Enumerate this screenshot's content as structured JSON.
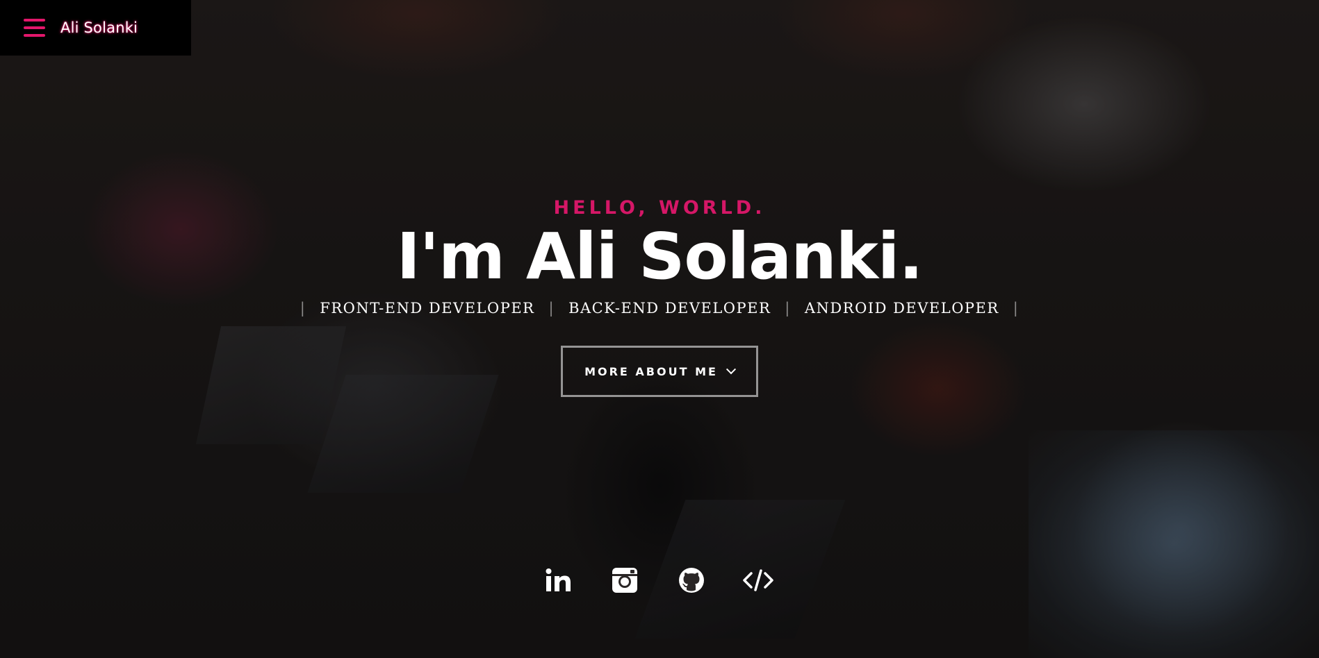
{
  "header": {
    "brand": "Ali Solanki",
    "menu_icon": "hamburger-menu-icon",
    "accent_color": "#e3176b"
  },
  "hero": {
    "greeting": "HELLO, WORLD.",
    "headline": "I'm Ali Solanki.",
    "roles": [
      "FRONT-END DEVELOPER",
      "BACK-END DEVELOPER",
      "ANDROID DEVELOPER"
    ],
    "separator": "|",
    "cta_label": "MORE ABOUT ME",
    "cta_icon": "chevron-down-icon",
    "greeting_color": "#d51767"
  },
  "social": [
    {
      "name": "linkedin",
      "icon": "linkedin-icon"
    },
    {
      "name": "instagram",
      "icon": "instagram-icon"
    },
    {
      "name": "github",
      "icon": "github-icon"
    },
    {
      "name": "code",
      "icon": "code-icon"
    }
  ]
}
